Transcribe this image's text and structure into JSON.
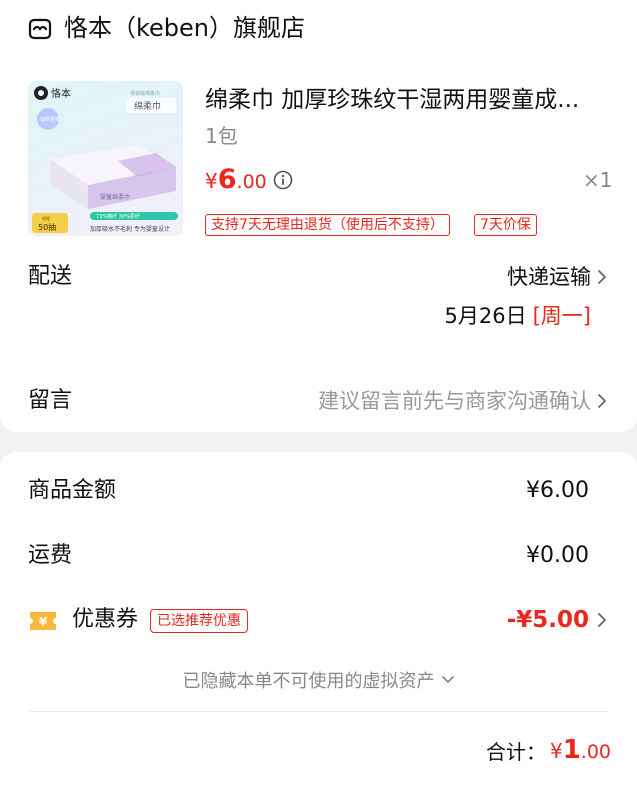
{
  "shop": {
    "name": "恪本（keben）旗舰店",
    "icon": "shop-icon"
  },
  "product": {
    "title": "绵柔巾 加厚珍珠纹干湿两用婴童成...",
    "spec": "1包",
    "price_currency": "¥",
    "price_int": "6",
    "price_dec": ".00",
    "quantity": "×1",
    "tags": [
      "支持7天无理由退货（使用后不支持）",
      "7天价保"
    ],
    "image": {
      "brand": "恪本",
      "product_name": "绵柔巾",
      "top_line": "母婴级绵柔巾",
      "badge": "加厚更柔",
      "count_small": "规格",
      "count": "50抽",
      "strip": "73%棉纤 30%原纤",
      "slogan": "加厚吸水不毛刺 专为婴童设计",
      "packet_text": "婴童绵柔巾"
    }
  },
  "delivery": {
    "label": "配送",
    "method": "快递运输",
    "date": "5月26日",
    "weekday": "[周一]"
  },
  "message": {
    "label": "留言",
    "placeholder": "建议留言前先与商家沟通确认"
  },
  "summary": {
    "goods_label": "商品金额",
    "goods_value": "¥6.00",
    "shipping_label": "运费",
    "shipping_value": "¥0.00",
    "coupon_label": "优惠券",
    "coupon_badge": "已选推荐优惠",
    "coupon_value": "-¥5.00",
    "hidden_assets": "已隐藏本单不可使用的虚拟资产",
    "total_label": "合计：",
    "total_currency": "¥",
    "total_int": "1",
    "total_dec": ".00"
  },
  "colors": {
    "accent": "#e8271e",
    "muted": "#888888",
    "coupon_icon": "#f6b93b"
  }
}
